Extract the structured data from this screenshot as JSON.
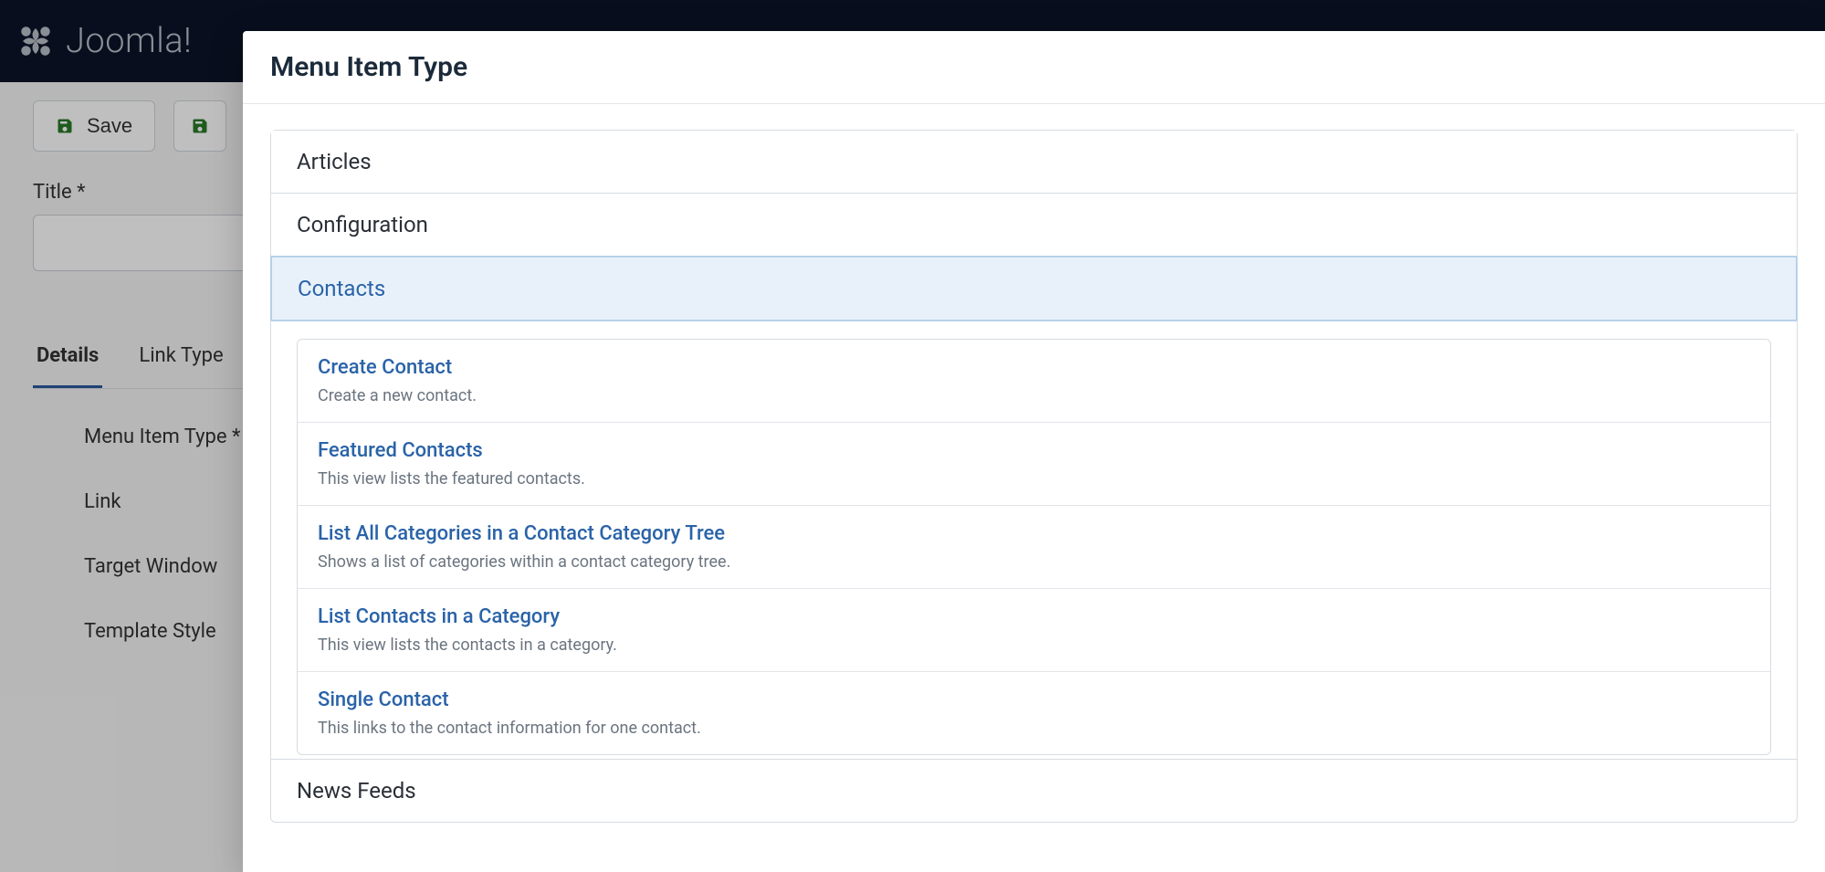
{
  "brand": "Joomla!",
  "toolbar": {
    "save_label": "Save"
  },
  "form": {
    "title_label": "Title *"
  },
  "tabs": {
    "details": "Details",
    "link_type": "Link Type"
  },
  "details": {
    "menu_item_type": "Menu Item Type *",
    "link": "Link",
    "target_window": "Target Window",
    "template_style": "Template Style"
  },
  "modal": {
    "title": "Menu Item Type",
    "sections": {
      "articles": "Articles",
      "configuration": "Configuration",
      "contacts": "Contacts",
      "news_feeds": "News Feeds"
    },
    "contacts_options": [
      {
        "title": "Create Contact",
        "desc": "Create a new contact."
      },
      {
        "title": "Featured Contacts",
        "desc": "This view lists the featured contacts."
      },
      {
        "title": "List All Categories in a Contact Category Tree",
        "desc": "Shows a list of categories within a contact category tree."
      },
      {
        "title": "List Contacts in a Category",
        "desc": "This view lists the contacts in a category."
      },
      {
        "title": "Single Contact",
        "desc": "This links to the contact information for one contact."
      }
    ]
  }
}
